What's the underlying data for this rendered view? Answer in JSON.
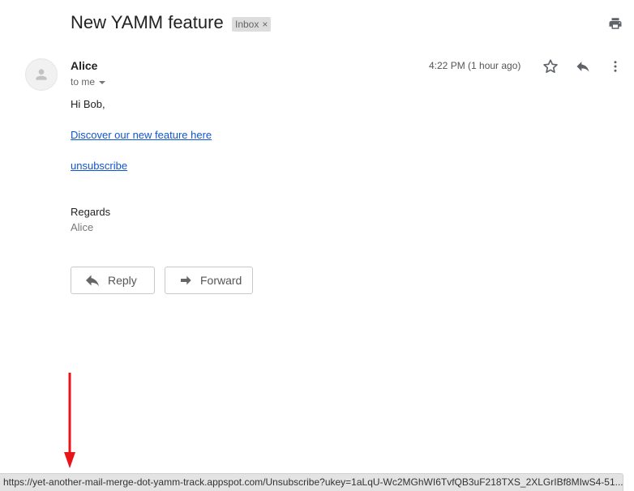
{
  "email": {
    "subject": "New YAMM feature",
    "label": "Inbox",
    "label_close": "×",
    "sender": "Alice",
    "recipient": "to me",
    "timestamp": "4:22 PM (1 hour ago)"
  },
  "body": {
    "greeting": "Hi Bob,",
    "feature_link": "Discover our new feature here ",
    "unsubscribe_link": "unsubscribe",
    "closing": "Regards",
    "signature": "Alice"
  },
  "actions": {
    "reply_label": "Reply",
    "forward_label": "Forward"
  },
  "status_bar": {
    "url": "https://yet-another-mail-merge-dot-yamm-track.appspot.com/Unsubscribe?ukey=1aLqU-Wc2MGhWI6TvfQB3uF218TXS_2XLGrIBf8MIwS4-51..."
  },
  "icons": {
    "print": "print-icon",
    "avatar": "person-icon",
    "star": "star-icon",
    "reply": "reply-icon",
    "more": "more-vert-icon",
    "forward": "forward-arrow-icon"
  },
  "colors": {
    "link": "#1155cc",
    "annotation_arrow": "#e8141a",
    "label_chip": "#dddddd"
  }
}
